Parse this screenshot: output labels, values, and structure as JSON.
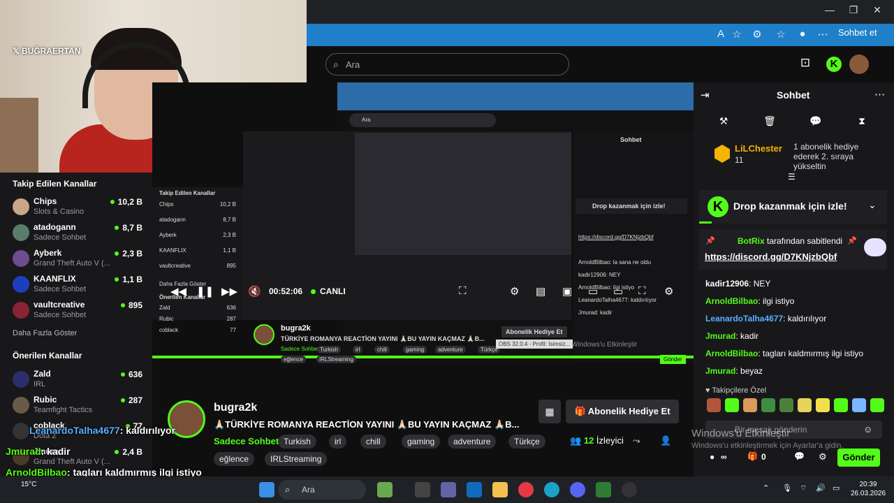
{
  "browser": {
    "sohbet_et": "Sohbet et"
  },
  "webcam": {
    "handle": "BUĞRAERTAN"
  },
  "header": {
    "search_placeholder": "Ara"
  },
  "sidebar": {
    "followed_title": "Takip Edilen Kanallar",
    "followed": [
      {
        "name": "Chips",
        "category": "Slots & Casino",
        "viewers": "10,2 B",
        "color": "#c9a58a"
      },
      {
        "name": "atadogann",
        "category": "Sadece Sohbet",
        "viewers": "8,7 B",
        "color": "#5a7d6a"
      },
      {
        "name": "Ayberk",
        "category": "Grand Theft Auto V (...",
        "viewers": "2,3 B",
        "color": "#6e4c90"
      },
      {
        "name": "KAANFLIX",
        "category": "Sadece Sohbet",
        "viewers": "1,1 B",
        "color": "#1d3fbf"
      },
      {
        "name": "vaultcreative",
        "category": "Sadece Sohbet",
        "viewers": "895",
        "color": "#8a2333"
      }
    ],
    "more_label": "Daha Fazla Göster",
    "recommended_title": "Önerilen Kanallar",
    "recommended": [
      {
        "name": "Zald",
        "category": "IRL",
        "viewers": "636",
        "color": "#2a2f6a"
      },
      {
        "name": "Rubic",
        "category": "Teamfight Tactics",
        "viewers": "287",
        "color": "#6a5a4a"
      },
      {
        "name": "coblack",
        "category": "Dota 2",
        "viewers": "77",
        "color": "#333"
      },
      {
        "name": "Jmurad",
        "category": "Grand Theft Auto V (...",
        "viewers": "2,4 B",
        "color": "#4a3a2a"
      }
    ]
  },
  "player": {
    "time": "00:52:06",
    "live": "CANLI",
    "nested_streamer": "bugra2k",
    "nested_title": "TÜRKİYE ROMANYA REACTİON YAYINI 🙏🏻BU YAYIN KAÇMAZ 🙏🏻B...",
    "nested_gift": "Abonelik Hediye Et",
    "nested_category": "Sadece Sohbet",
    "nested_tags": [
      "Turkish",
      "irl",
      "chill",
      "gaming",
      "adventure",
      "Türkçe"
    ],
    "nested_tags2": [
      "eğlence",
      "IRLStreaming"
    ],
    "nested_chat_title": "Sohbet",
    "nested_drop": "Drop kazanmak için izle!",
    "nested_link": "https://discord.gg/D7KNjzbQbf",
    "nested_msgs": [
      "ArnoldBilbao: la sana ne oldu",
      "kadir12906: NEY",
      "ArnoldBilbao: ilgi istiyo",
      "LeanardoTalha4677: kaldırılıyor",
      "Jmurad: kadir"
    ],
    "nested_send": "Gönder",
    "nested_search": "Ara",
    "nested_followed": "Takip Edilen Kanallar",
    "nested_channels": [
      {
        "name": "Chips",
        "viewers": "10,2 B"
      },
      {
        "name": "atadogann",
        "viewers": "8,7 B"
      },
      {
        "name": "Ayberk",
        "viewers": "2,3 B"
      },
      {
        "name": "KAANFLIX",
        "viewers": "1,1 B"
      },
      {
        "name": "vaultcreative",
        "viewers": "895"
      }
    ],
    "nested_more": "Daha Fazla Göster",
    "nested_recommended": "Önerilen Kanallar",
    "nested_rec": [
      {
        "name": "Zald",
        "viewers": "636"
      },
      {
        "name": "Rubic",
        "viewers": "287"
      },
      {
        "name": "coblack",
        "viewers": "77"
      }
    ],
    "windows_mark": "Windows'u Etkinleştir",
    "obs_label": "OBS 32.0.4 - Profil: İsimsiz..."
  },
  "stream": {
    "streamer": "bugra2k",
    "title": "🙏🏻TÜRKİYE ROMANYA REACTİON YAYINI 🙏🏻BU YAYIN KAÇMAZ 🙏🏻B...",
    "category": "Sadece Sohbet",
    "tags": [
      "Turkish",
      "irl",
      "chill",
      "gaming",
      "adventure",
      "Türkçe"
    ],
    "tags2": [
      "eğlence",
      "IRLStreaming"
    ],
    "gift_label": "Abonelik Hediye Et",
    "viewer_count": "12",
    "viewer_label": "İzleyici"
  },
  "chat": {
    "title": "Sohbet",
    "top_gifter_name": "LiLChester",
    "top_gifter_count": "11",
    "top_gifter_text": "1 abonelik hediye ederek 2. sıraya yükseltin",
    "drop_label": "Drop kazanmak için izle!",
    "pinned_by_user": "BotRix",
    "pinned_by_text": "tarafından sabitlendi",
    "pinned_link": "https://discord.gg/D7KNjzbQbf",
    "messages": [
      {
        "user": "kadir12906",
        "text": "NEY",
        "color": "#ffffff"
      },
      {
        "user": "ArnoldBilbao",
        "text": "ilgi istiyo",
        "color": "#53fc18"
      },
      {
        "user": "LeanardoTalha4677",
        "text": "kaldırılıyor",
        "color": "#5ab0ff"
      },
      {
        "user": "Jmurad",
        "text": "kadir",
        "color": "#53fc18"
      },
      {
        "user": "ArnoldBilbao",
        "text": "tagları kaldmırmış ilgi istiyo",
        "color": "#53fc18"
      },
      {
        "user": "Jmurad",
        "text": "beyaz",
        "color": "#53fc18"
      }
    ],
    "followers_only": "Takipçilere Özel",
    "input_placeholder": "Bir mesajı gönderin",
    "points": "∞",
    "gifts": "0",
    "send_label": "Gönder",
    "win_activate": "Windows'u Etkinleştir",
    "win_activate_sub": "Windows'u etkinleştirmek için Ayarlar'a gidin."
  },
  "overlay": [
    {
      "user": "LeanardoTalha4677",
      "text": ": kaldırılıyor"
    },
    {
      "user": "Jmurad",
      "text": ": kadir"
    },
    {
      "user": "ArnoldBilbao",
      "text": ": tagları kaldmırmış ilgi istiyo"
    },
    {
      "user": "Jmurad",
      "text": ": beyaz"
    }
  ],
  "taskbar": {
    "search_placeholder": "Ara",
    "temperature": "15°C",
    "time": "20:39",
    "date": "26.03.2026"
  }
}
